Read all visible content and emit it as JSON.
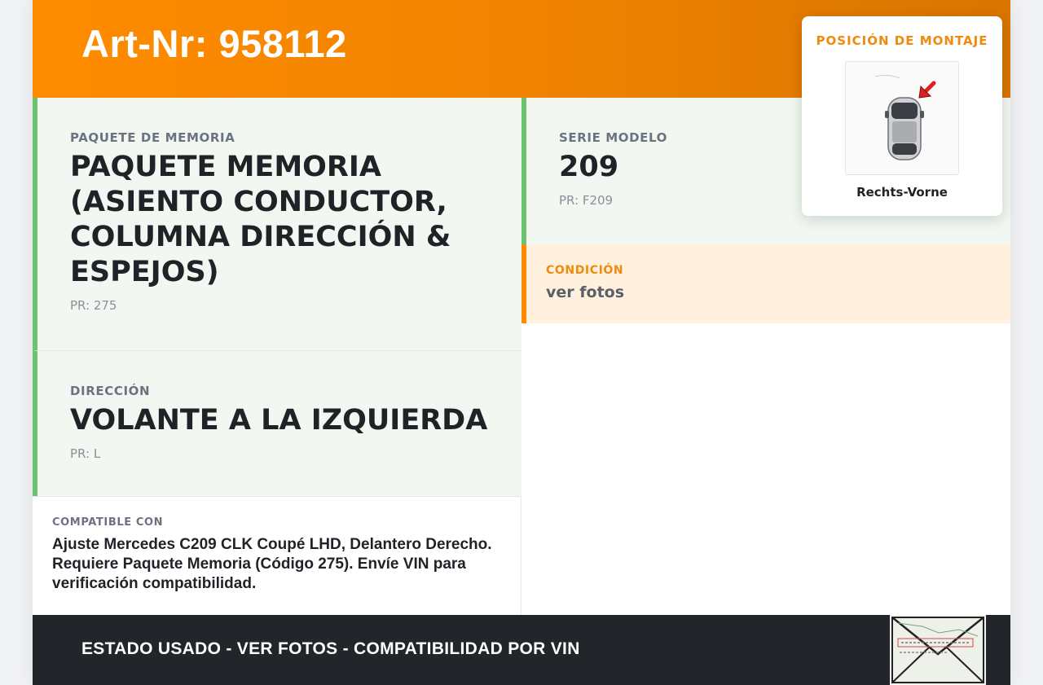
{
  "header": {
    "art_nr": "Art-Nr: 958112"
  },
  "memory_package": {
    "label": "PAQUETE DE MEMORIA",
    "value": "PAQUETE MEMORIA (ASIENTO CONDUCTOR, COLUMNA DIRECCIÓN & ESPEJOS)",
    "code": "PR: 275"
  },
  "steering": {
    "label": "DIRECCIÓN",
    "value": "VOLANTE A LA IZQUIERDA",
    "code": "PR: L"
  },
  "model_series": {
    "label": "SERIE MODELO",
    "value": "209",
    "code": "PR: F209"
  },
  "condition": {
    "label": "CONDICIÓN",
    "value": "ver fotos"
  },
  "compatibility": {
    "label": "COMPATIBLE CON",
    "text": "Ajuste Mercedes C209 CLK Coupé LHD, Delantero Derecho. Requiere Paquete Memoria (Código 275). Envíe VIN para verificación compatibilidad."
  },
  "mount_position": {
    "title": "POSICIÓN DE MONTAJE",
    "position": "Rechts-Vorne",
    "icon": "car-top-view-icon",
    "arrow_color": "#e02020"
  },
  "footer": {
    "text": "ESTADO USADO - VER FOTOS - COMPATIBILIDAD POR VIN",
    "envelope_icon": "envelope-label-icon"
  },
  "colors": {
    "accent_orange": "#ff8c00",
    "green_border": "#6cc26f",
    "footer_bg": "#22252a"
  }
}
